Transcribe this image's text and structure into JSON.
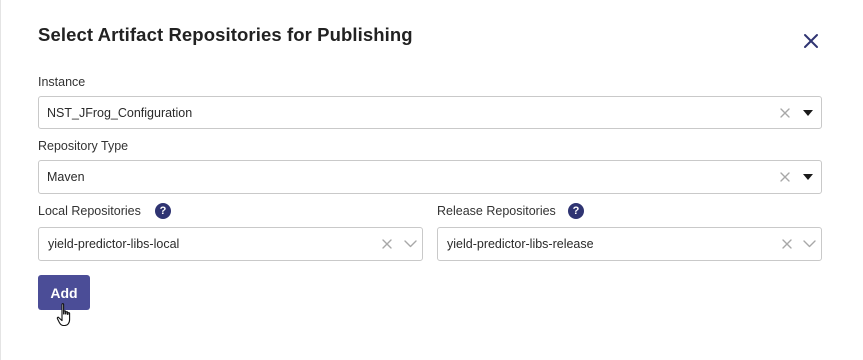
{
  "dialog": {
    "title": "Select Artifact Repositories for Publishing",
    "close_icon": "close-icon"
  },
  "instance": {
    "label": "Instance",
    "value": "NST_JFrog_Configuration"
  },
  "repository_type": {
    "label": "Repository Type",
    "value": "Maven"
  },
  "local_repositories": {
    "label": "Local Repositories",
    "help_glyph": "?",
    "value": "yield-predictor-libs-local"
  },
  "release_repositories": {
    "label": "Release Repositories",
    "help_glyph": "?",
    "value": "yield-predictor-libs-release"
  },
  "actions": {
    "add_label": "Add"
  },
  "colors": {
    "primary_button": "#4b4d97",
    "help_icon": "#2f3472",
    "close_icon": "#2f3472",
    "border": "#c9c9c9"
  }
}
